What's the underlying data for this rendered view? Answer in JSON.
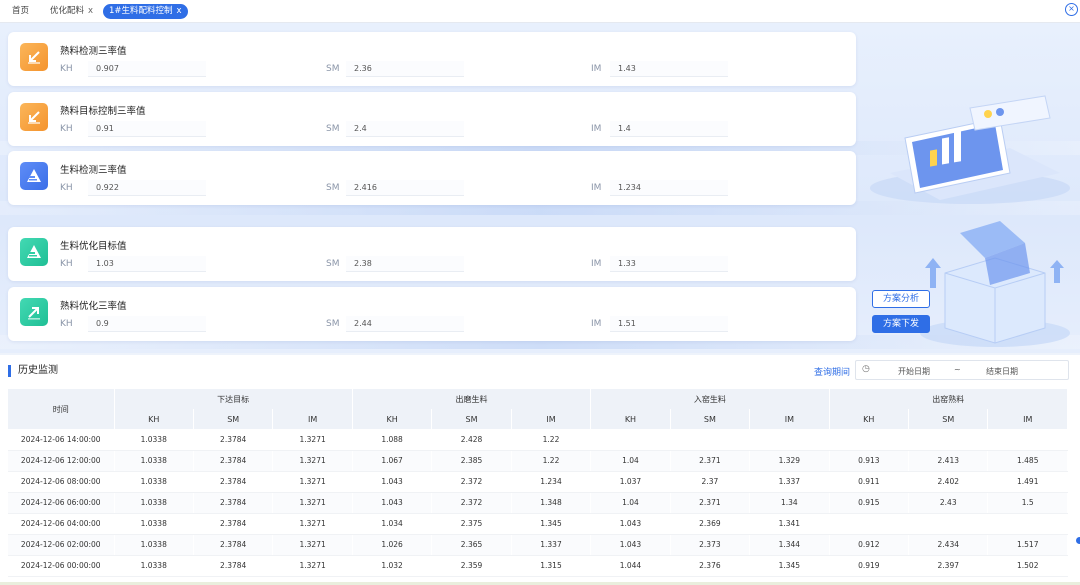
{
  "tabs": [
    {
      "label": "首页",
      "closable": false
    },
    {
      "label": "优化配料",
      "closable": true
    },
    {
      "label": "1#生料配料控制",
      "closable": true,
      "active": true
    }
  ],
  "close_symbol": "x",
  "cards": [
    {
      "title": "熟料检测三率值",
      "icon": "arrow-down-left-icon",
      "color": "orange",
      "KH": "0.907",
      "SM": "2.36",
      "IM": "1.43"
    },
    {
      "title": "熟料目标控制三率值",
      "icon": "arrow-down-left-icon",
      "color": "orange",
      "KH": "0.91",
      "SM": "2.4",
      "IM": "1.4"
    },
    {
      "title": "生料检测三率值",
      "icon": "pyramid-icon",
      "color": "blue",
      "KH": "0.922",
      "SM": "2.416",
      "IM": "1.234"
    },
    {
      "title": "生料优化目标值",
      "icon": "pyramid-icon",
      "color": "green",
      "KH": "1.03",
      "SM": "2.38",
      "IM": "1.33"
    },
    {
      "title": "熟料优化三率值",
      "icon": "arrow-up-right-icon",
      "color": "green",
      "KH": "0.9",
      "SM": "2.44",
      "IM": "1.51"
    }
  ],
  "labels": {
    "kh": "KH",
    "sm": "SM",
    "im": "IM"
  },
  "buttons": {
    "analysis": "方案分析",
    "issue": "方案下发"
  },
  "history": {
    "title": "历史监测",
    "query_label": "查询期间",
    "start_placeholder": "开始日期",
    "range_separator": "~",
    "end_placeholder": "结束日期",
    "time_header": "时间",
    "groups": [
      "下达目标",
      "出磨生料",
      "入窑生料",
      "出窑熟料"
    ],
    "sub_headers": [
      "KH",
      "SM",
      "IM"
    ],
    "rows": [
      [
        "2024-12-06 14:00:00",
        "1.0338",
        "2.3784",
        "1.3271",
        "1.088",
        "2.428",
        "1.22",
        "",
        "",
        "",
        "",
        "",
        ""
      ],
      [
        "2024-12-06 12:00:00",
        "1.0338",
        "2.3784",
        "1.3271",
        "1.067",
        "2.385",
        "1.22",
        "1.04",
        "2.371",
        "1.329",
        "0.913",
        "2.413",
        "1.485"
      ],
      [
        "2024-12-06 08:00:00",
        "1.0338",
        "2.3784",
        "1.3271",
        "1.043",
        "2.372",
        "1.234",
        "1.037",
        "2.37",
        "1.337",
        "0.911",
        "2.402",
        "1.491"
      ],
      [
        "2024-12-06 06:00:00",
        "1.0338",
        "2.3784",
        "1.3271",
        "1.043",
        "2.372",
        "1.348",
        "1.04",
        "2.371",
        "1.34",
        "0.915",
        "2.43",
        "1.5"
      ],
      [
        "2024-12-06 04:00:00",
        "1.0338",
        "2.3784",
        "1.3271",
        "1.034",
        "2.375",
        "1.345",
        "1.043",
        "2.369",
        "1.341",
        "",
        "",
        ""
      ],
      [
        "2024-12-06 02:00:00",
        "1.0338",
        "2.3784",
        "1.3271",
        "1.026",
        "2.365",
        "1.337",
        "1.043",
        "2.373",
        "1.344",
        "0.912",
        "2.434",
        "1.517"
      ],
      [
        "2024-12-06 00:00:00",
        "1.0338",
        "2.3784",
        "1.3271",
        "1.032",
        "2.359",
        "1.315",
        "1.044",
        "2.376",
        "1.345",
        "0.919",
        "2.397",
        "1.502"
      ]
    ]
  },
  "colors": {
    "accent": "#2f6ee6",
    "orange": "#f4932d",
    "blue": "#3a6ee8",
    "green": "#1fbf95"
  }
}
